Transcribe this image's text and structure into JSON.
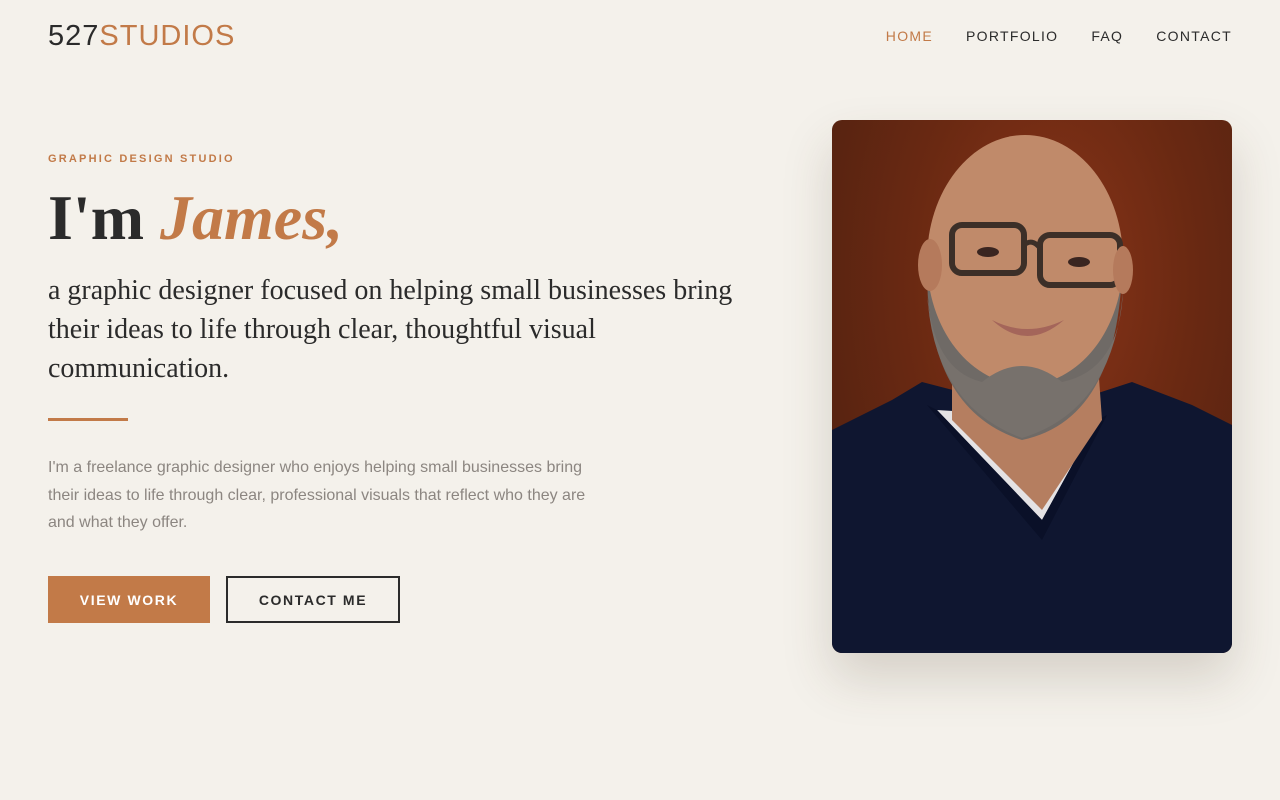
{
  "header": {
    "logo_number": "527",
    "logo_word": "STUDIOS",
    "nav": [
      {
        "label": "HOME",
        "active": true
      },
      {
        "label": "PORTFOLIO",
        "active": false
      },
      {
        "label": "FAQ",
        "active": false
      },
      {
        "label": "CONTACT",
        "active": false
      }
    ]
  },
  "hero": {
    "eyebrow": "GRAPHIC DESIGN STUDIO",
    "greeting": "I'm",
    "name": "James,",
    "subhead": "a graphic designer focused on helping small businesses bring their ideas to life through clear, thoughtful visual communication.",
    "body": "I'm a freelance graphic designer who enjoys helping small businesses bring their ideas to life through clear, professional visuals that reflect who they are and what they offer.",
    "primary_button": "VIEW WORK",
    "secondary_button": "CONTACT ME"
  },
  "colors": {
    "background": "#f4f1eb",
    "accent": "#c27a48",
    "text": "#2b2b2b",
    "muted": "#8c8681"
  }
}
